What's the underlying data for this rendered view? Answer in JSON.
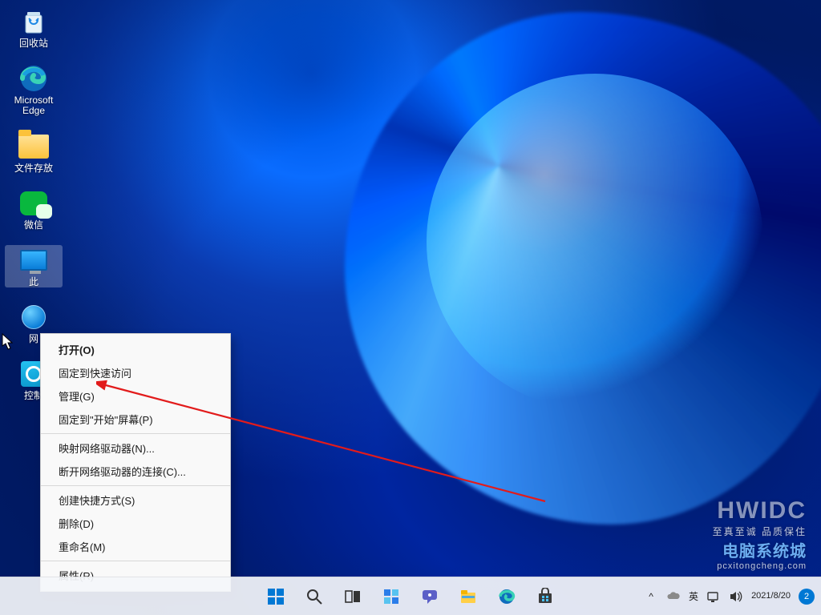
{
  "desktop": {
    "icons": [
      {
        "id": "recycle-bin",
        "label": "回收站"
      },
      {
        "id": "edge",
        "label": "Microsoft Edge"
      },
      {
        "id": "folder",
        "label": "文件存放"
      },
      {
        "id": "wechat",
        "label": "微信"
      },
      {
        "id": "this-pc",
        "label": "此"
      },
      {
        "id": "network",
        "label": "网"
      },
      {
        "id": "control-panel",
        "label": "控制"
      }
    ]
  },
  "context_menu": {
    "groups": [
      [
        {
          "label": "打开(O)",
          "bold": true
        },
        {
          "label": "固定到快速访问"
        },
        {
          "label": "管理(G)"
        },
        {
          "label": "固定到\"开始\"屏幕(P)"
        }
      ],
      [
        {
          "label": "映射网络驱动器(N)..."
        },
        {
          "label": "断开网络驱动器的连接(C)..."
        }
      ],
      [
        {
          "label": "创建快捷方式(S)"
        },
        {
          "label": "删除(D)"
        },
        {
          "label": "重命名(M)"
        }
      ],
      [
        {
          "label": "属性(R)"
        }
      ]
    ]
  },
  "watermark": {
    "title": "HWIDC",
    "subtitle": "至真至诚 品质保住",
    "site_cn": "电脑系统城",
    "url": "pcxitongcheng.com"
  },
  "taskbar": {
    "items": [
      "start",
      "search",
      "task-view",
      "widgets",
      "chat",
      "explorer",
      "edge",
      "store"
    ]
  },
  "systray": {
    "chevron": "^",
    "ime": "英",
    "time": "",
    "date": "2021/8/20",
    "notif_count": "2"
  }
}
